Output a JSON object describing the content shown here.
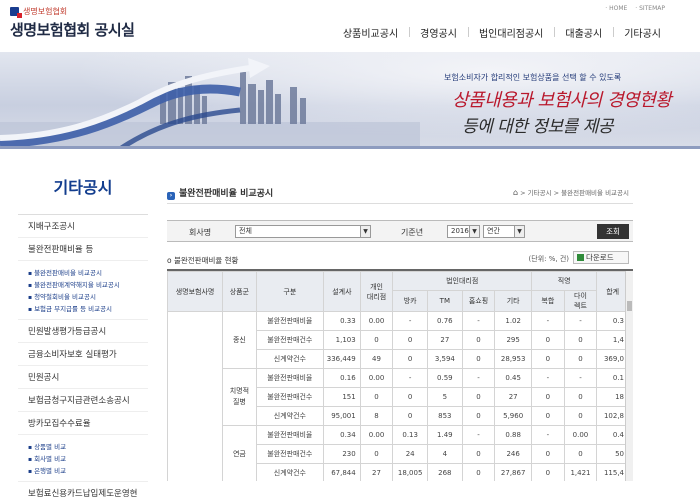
{
  "header": {
    "logo_sub": "생명보험협회",
    "logo_main": "생명보험협회 공시실",
    "toplinks": [
      "· HOME",
      "· SITEMAP"
    ],
    "nav": [
      "상품비교공시",
      "경영공시",
      "법인대리점공시",
      "대출공시",
      "기타공시"
    ]
  },
  "banner": {
    "line1": "보험소비자가 합리적인 보험상품을 선택 할 수 있도록",
    "line2": "상품내용과 보험사의 경영현황",
    "line3": "등에 대한 정보를 제공"
  },
  "sidebar": {
    "title": "기타공시",
    "menu1": "지배구조공시",
    "menu2": "불완전판매비율 등",
    "sub1": [
      "불완전판매비율 비교공시",
      "불완전판매계약해지율 비교공시",
      "청약철회비율 비교공시",
      "보험금 부지급률 등 비교공시"
    ],
    "menu3": "민원발생평가등급공시",
    "menu4": "금융소비자보호 실태평가",
    "menu5": "민원공시",
    "menu6": "보험금청구지급관련소송공시",
    "menu7": "방카모집수수료율",
    "sub2": [
      "상품별 비교",
      "회사별 비교",
      "은행별 비교"
    ],
    "menu8": "보험료신용카드납입제도운영현"
  },
  "content": {
    "title": "불완전판매비율 비교공시",
    "breadcrumb": [
      "> 기타공시",
      "> 불완전판매비율 비교공시"
    ],
    "filter": {
      "company_label": "회사명",
      "company_value": "전체",
      "period_label": "기준년",
      "year_value": "2016",
      "period_value": "연간",
      "search_label": "조회"
    },
    "sub_title": "o 불완전판매비율 현황",
    "unit": "(단위: %, 건)",
    "download": "다운로드",
    "table": {
      "h_company": "생명보험사명",
      "h_group": "상품군",
      "h_kind": "구분",
      "h_planner": "설계사",
      "h_individual": "개인\n대리점",
      "h_corp": "법인대리점",
      "h_bank": "방카",
      "h_tm": "TM",
      "h_home": "홈쇼핑",
      "h_etc": "기타",
      "h_direct": "직영",
      "h_mixed": "복합",
      "h_directm": "다이\n렉트",
      "h_total": "합계",
      "groups": [
        {
          "name": "종신",
          "rows": [
            {
              "kind": "불완전판매비율",
              "v": [
                "0.33",
                "0.00",
                "-",
                "0.76",
                "-",
                "1.02",
                "-",
                "-",
                "0.3"
              ]
            },
            {
              "kind": "불완전판매건수",
              "v": [
                "1,103",
                "0",
                "0",
                "27",
                "0",
                "295",
                "0",
                "0",
                "1,4"
              ]
            },
            {
              "kind": "신계약건수",
              "v": [
                "336,449",
                "49",
                "0",
                "3,594",
                "0",
                "28,953",
                "0",
                "0",
                "369,0"
              ]
            }
          ]
        },
        {
          "name": "치명적\n질병",
          "rows": [
            {
              "kind": "불완전판매비율",
              "v": [
                "0.16",
                "0.00",
                "-",
                "0.59",
                "-",
                "0.45",
                "-",
                "-",
                "0.1"
              ]
            },
            {
              "kind": "불완전판매건수",
              "v": [
                "151",
                "0",
                "0",
                "5",
                "0",
                "27",
                "0",
                "0",
                "18"
              ]
            },
            {
              "kind": "신계약건수",
              "v": [
                "95,001",
                "8",
                "0",
                "853",
                "0",
                "5,960",
                "0",
                "0",
                "102,8"
              ]
            }
          ]
        },
        {
          "name": "연금",
          "rows": [
            {
              "kind": "불완전판매비율",
              "v": [
                "0.34",
                "0.00",
                "0.13",
                "1.49",
                "-",
                "0.88",
                "-",
                "0.00",
                "0.4"
              ]
            },
            {
              "kind": "불완전판매건수",
              "v": [
                "230",
                "0",
                "24",
                "4",
                "0",
                "246",
                "0",
                "0",
                "50"
              ]
            },
            {
              "kind": "신계약건수",
              "v": [
                "67,844",
                "27",
                "18,005",
                "268",
                "0",
                "27,867",
                "0",
                "1,421",
                "115,4"
              ]
            }
          ]
        }
      ]
    }
  }
}
